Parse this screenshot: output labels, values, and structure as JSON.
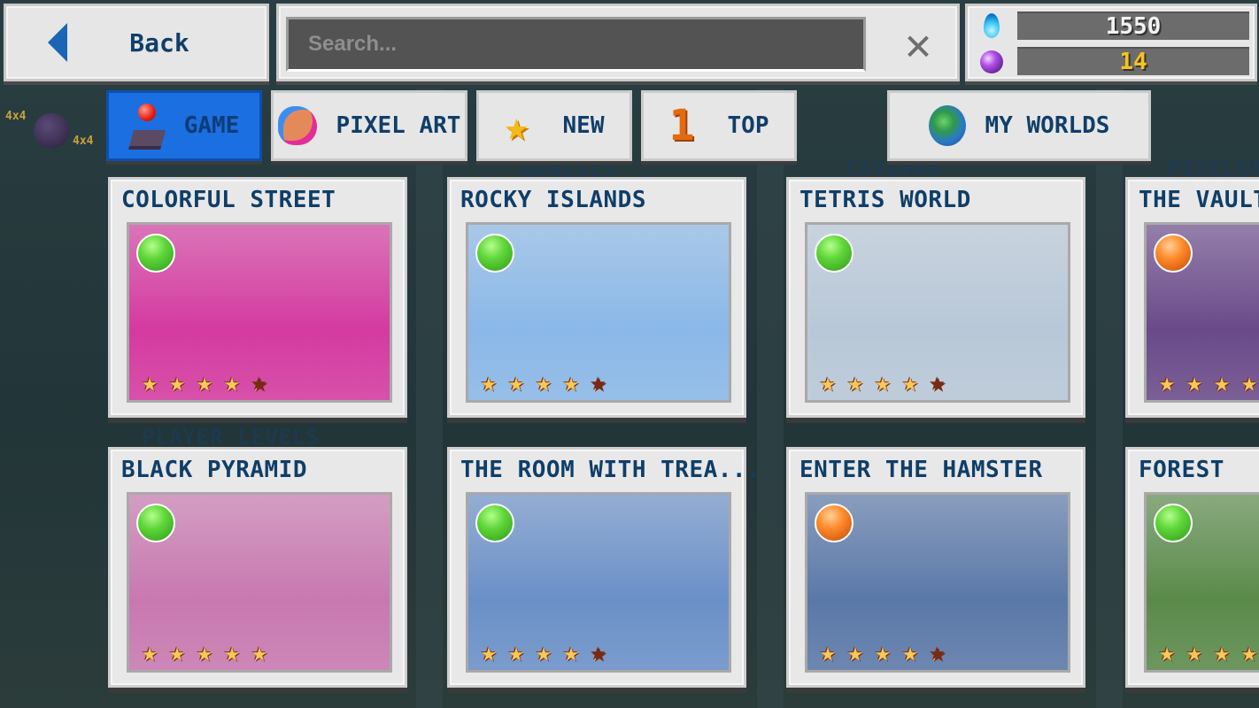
{
  "topbar": {
    "back_label": "Back",
    "search_placeholder": "Search...",
    "search_value": "",
    "clear_label": "✕",
    "currency": {
      "blue_flame": "1550",
      "purple_orb": "14"
    }
  },
  "tabs": [
    {
      "id": "game",
      "label": "GAME",
      "icon": "joystick-icon",
      "active": true
    },
    {
      "id": "pixel-art",
      "label": "PIXEL ART",
      "icon": "palette-icon",
      "active": false
    },
    {
      "id": "new",
      "label": "NEW",
      "icon": "star-icon",
      "active": false
    },
    {
      "id": "top",
      "label": "TOP",
      "icon": "number-one-icon",
      "active": false
    },
    {
      "id": "my-worlds",
      "label": "MY WORLDS",
      "icon": "globe-icon",
      "active": false
    }
  ],
  "background_labels": [
    "GENESIS",
    "CAVEMAN",
    "PIXELART",
    "PLAYER LEVELS"
  ],
  "side_badges": [
    "4x4",
    "4x4"
  ],
  "levels": [
    {
      "title": "COLORFUL STREET",
      "difficulty": "easy",
      "rating": 4.5,
      "max_rating": 5,
      "theme": "#d43aa0"
    },
    {
      "title": "ROCKY ISLANDS",
      "difficulty": "easy",
      "rating": 4.5,
      "max_rating": 5,
      "theme": "#8ab8e8"
    },
    {
      "title": "TETRIS WORLD",
      "difficulty": "easy",
      "rating": 4.4,
      "max_rating": 5,
      "theme": "#b8c8d8"
    },
    {
      "title": "THE VAULT",
      "difficulty": "hard",
      "rating": 4,
      "max_rating": 5,
      "theme": "#6a4a8a"
    },
    {
      "title": "BLACK PYRAMID",
      "difficulty": "easy",
      "rating": 4.8,
      "max_rating": 5,
      "theme": "#c878b0"
    },
    {
      "title": "THE ROOM WITH TREA...",
      "difficulty": "easy",
      "rating": 4.3,
      "max_rating": 5,
      "theme": "#6a90c8"
    },
    {
      "title": "ENTER THE HAMSTER",
      "difficulty": "hard",
      "rating": 4.3,
      "max_rating": 5,
      "theme": "#5a78a8"
    },
    {
      "title": "FOREST",
      "difficulty": "easy",
      "rating": 4,
      "max_rating": 5,
      "theme": "#5a8a4a"
    }
  ]
}
